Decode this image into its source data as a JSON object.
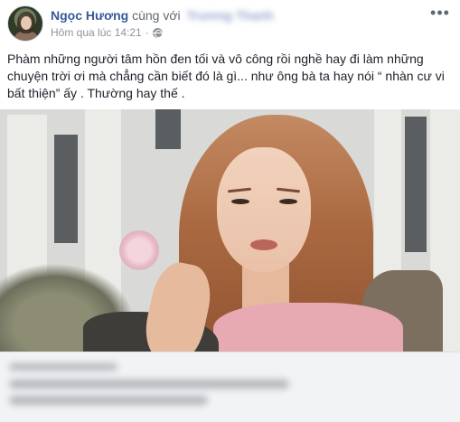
{
  "post": {
    "author": "Ngọc Hương",
    "with_text": "cùng với",
    "tagged_person": "Trương Thanh",
    "timestamp": "Hôm qua lúc 14:21",
    "dot": "·",
    "privacy_icon": "globe-icon",
    "more_icon": "more-horizontal-icon",
    "more_symbol": "•••",
    "text": "Phàm những người tâm hồn đen tối và vô công rồi nghề hay đi làm những chuyện trời ơi mà chẳng cần biết đó là gì... như ông bà ta hay nói “ nhàn cư vi bất thiện” ấy . Thường hay thế ."
  },
  "colors": {
    "author": "#385898",
    "meta": "#90949c",
    "text": "#1d2129",
    "preview_bg": "#f2f3f5"
  }
}
